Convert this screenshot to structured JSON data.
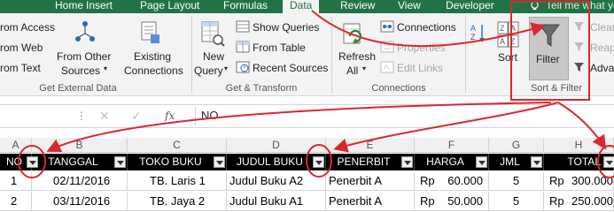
{
  "tabs": [
    {
      "label": "Home",
      "active": false
    },
    {
      "label": "Insert",
      "active": false
    },
    {
      "label": "Page Layout",
      "active": false
    },
    {
      "label": "Formulas",
      "active": false
    },
    {
      "label": "Data",
      "active": true
    },
    {
      "label": "Review",
      "active": false
    },
    {
      "label": "View",
      "active": false
    },
    {
      "label": "Developer",
      "active": false
    }
  ],
  "tell_me": "Tell me what you",
  "ribbon": {
    "get_external_data": {
      "from_access": "rom Access",
      "from_web": "rom Web",
      "from_text": "rom Text",
      "from_other_sources_1": "From Other",
      "from_other_sources_2": "Sources",
      "existing_connections_1": "Existing",
      "existing_connections_2": "Connections",
      "group_label": "Get External Data"
    },
    "get_transform": {
      "new_query_1": "New",
      "new_query_2": "Query",
      "show_queries": "Show Queries",
      "from_table": "From Table",
      "recent_sources": "Recent Sources",
      "group_label": "Get & Transform"
    },
    "connections": {
      "refresh_all_1": "Refresh",
      "refresh_all_2": "All",
      "connections": "Connections",
      "properties": "Properties",
      "edit_links": "Edit Links",
      "group_label": "Connections"
    },
    "sort_filter": {
      "sort": "Sort",
      "filter": "Filter",
      "clear": "Clear",
      "reapply": "Reap",
      "advanced": "Adva",
      "group_label": "Sort & Filter"
    }
  },
  "formula_bar": {
    "fx": "fx",
    "content": "NO"
  },
  "columns": [
    "A",
    "B",
    "C",
    "D",
    "E",
    "F",
    "G",
    "H"
  ],
  "table": {
    "headers": [
      "NO",
      "TANGGAL",
      "TOKO BUKU",
      "JUDUL BUKU",
      "PENERBIT",
      "HARGA",
      "JML",
      "TOTAL"
    ],
    "rows": [
      {
        "no": "1",
        "tanggal": "02/11/2016",
        "toko": "TB. Laris 1",
        "judul": "Judul Buku A2",
        "penerbit": "Penerbit A",
        "rp": "Rp",
        "harga": "60.000",
        "jml": "5",
        "rp2": "Rp",
        "total": "300.000"
      },
      {
        "no": "2",
        "tanggal": "03/11/2016",
        "toko": "TB. Jaya 2",
        "judul": "Judul Buku A1",
        "penerbit": "Penerbit A",
        "rp": "Rp",
        "harga": "50.000",
        "jml": "5",
        "rp2": "Rp",
        "total": "250.000"
      }
    ]
  },
  "colors": {
    "ribbon_green": "#217346",
    "annotation_red": "#d9282f",
    "header_black": "#000000"
  }
}
